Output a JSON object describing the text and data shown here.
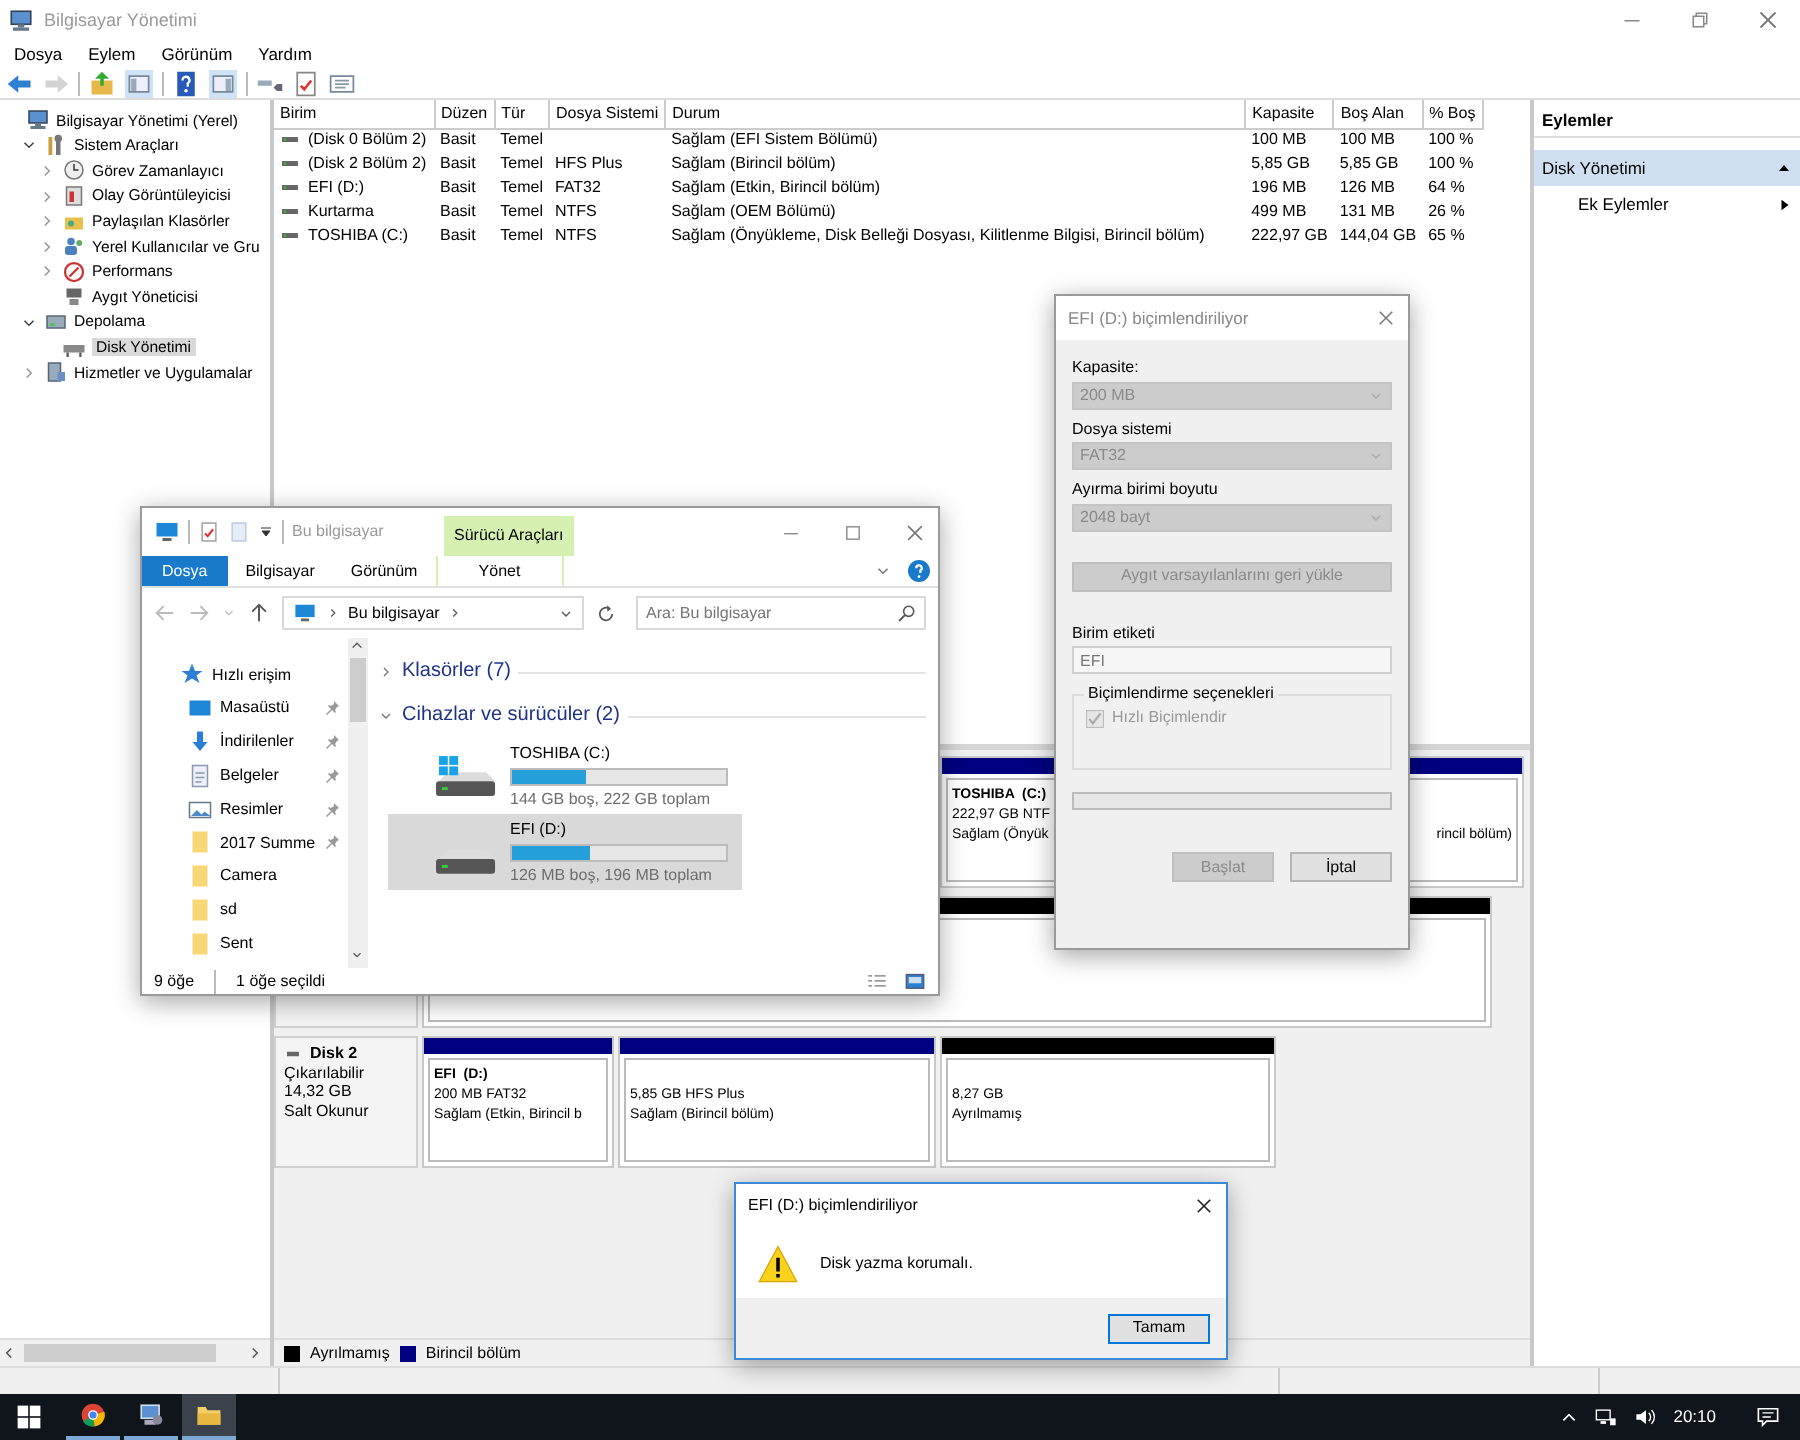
{
  "main_window": {
    "title": "Bilgisayar Yönetimi",
    "menu": [
      "Dosya",
      "Eylem",
      "Görünüm",
      "Yardım"
    ]
  },
  "toolbar": [
    {
      "kind": "back",
      "disabled": false
    },
    {
      "kind": "forward",
      "disabled": true
    },
    {
      "kind": "up",
      "disabled": false
    },
    {
      "kind": "tree",
      "disabled": false
    },
    {
      "kind": "help",
      "disabled": false
    },
    {
      "kind": "pane",
      "disabled": false
    },
    {
      "kind": "connect",
      "disabled": false
    },
    {
      "kind": "check",
      "disabled": false
    },
    {
      "kind": "properties",
      "disabled": false
    }
  ],
  "tree": [
    {
      "label": "Bilgisayar Yönetimi (Yerel)",
      "kind": "computer",
      "selected": false,
      "children": [
        {
          "label": "Sistem Araçları",
          "kind": "tools",
          "expanded": true,
          "selected": false,
          "children": [
            {
              "label": "Görev Zamanlayıcı",
              "kind": "clock",
              "expanded": false,
              "selected": false
            },
            {
              "label": "Olay Görüntüleyicisi",
              "kind": "log",
              "expanded": false,
              "selected": false
            },
            {
              "label": "Paylaşılan Klasörler",
              "kind": "share",
              "expanded": false,
              "selected": false
            },
            {
              "label": "Yerel Kullanıcılar ve Gru",
              "kind": "users",
              "expanded": false,
              "selected": false
            },
            {
              "label": "Performans",
              "kind": "perf",
              "expanded": false,
              "selected": false
            },
            {
              "label": "Aygıt Yöneticisi",
              "kind": "device",
              "selected": false
            }
          ]
        },
        {
          "label": "Depolama",
          "kind": "storage",
          "expanded": true,
          "selected": false,
          "children": [
            {
              "label": "Disk Yönetimi",
              "kind": "disk",
              "selected": true
            }
          ]
        },
        {
          "label": "Hizmetler ve Uygulamalar",
          "kind": "services",
          "expanded": false,
          "selected": false
        }
      ]
    }
  ],
  "volume_table": {
    "columns": [
      "Birim",
      "Düzen",
      "Tür",
      "Dosya Sistemi",
      "Durum",
      "Kapasite",
      "Boş Alan",
      "% Boş"
    ],
    "rows": [
      [
        "(Disk 0 Bölüm 2)",
        "Basit",
        "Temel",
        "",
        "Sağlam (EFI Sistem Bölümü)",
        "100 MB",
        "100 MB",
        "100 %"
      ],
      [
        "(Disk 2 Bölüm 2)",
        "Basit",
        "Temel",
        "HFS Plus",
        "Sağlam (Birincil bölüm)",
        "5,85 GB",
        "5,85 GB",
        "100 %"
      ],
      [
        "EFI (D:)",
        "Basit",
        "Temel",
        "FAT32",
        "Sağlam (Etkin, Birincil bölüm)",
        "196 MB",
        "126 MB",
        "64 %"
      ],
      [
        "Kurtarma",
        "Basit",
        "Temel",
        "NTFS",
        "Sağlam (OEM Bölümü)",
        "499 MB",
        "131 MB",
        "26 %"
      ],
      [
        "TOSHIBA (C:)",
        "Basit",
        "Temel",
        "NTFS",
        "Sağlam (Önyükleme, Disk Belleği Dosyası, Kilitlenme Bilgisi, Birincil bölüm)",
        "222,97 GB",
        "144,04 GB",
        "65 %"
      ]
    ]
  },
  "disks": [
    {
      "partitions": [
        {
          "kind": "primary",
          "title": "TOSHIBA  (C:)",
          "lines": [
            "222,97 GB NTF",
            "Sağlam (Önyük"
          ],
          "tail": "rincil bölüm)"
        }
      ]
    },
    {
      "partitions": [
        {
          "kind": "unallocated"
        }
      ]
    },
    {
      "name": "Disk 2",
      "lines": [
        "Çıkarılabilir",
        "14,32 GB",
        "Salt Okunur"
      ],
      "partitions": [
        {
          "kind": "primary",
          "title": "EFI  (D:)",
          "lines": [
            "200 MB FAT32",
            "Sağlam (Etkin, Birincil b"
          ]
        },
        {
          "kind": "primary",
          "lines": [
            "5,85 GB HFS Plus",
            "Sağlam (Birincil bölüm)"
          ]
        },
        {
          "kind": "unallocated",
          "lines": [
            "8,27 GB",
            "Ayrılmamış"
          ]
        }
      ]
    }
  ],
  "legend": [
    {
      "label": "Ayrılmamış",
      "color": "#000000"
    },
    {
      "label": "Birincil bölüm",
      "color": "#000080"
    }
  ],
  "actions": {
    "title": "Eylemler",
    "section": {
      "label": "Disk Yönetimi",
      "expanded": true
    },
    "items": [
      "Ek Eylemler"
    ]
  },
  "explorer": {
    "title": "Bu bilgisayar",
    "context_group": "Sürücü Araçları",
    "tabs": [
      {
        "label": "Dosya",
        "kind": "file"
      },
      {
        "label": "Bilgisayar",
        "kind": "tab"
      },
      {
        "label": "Görünüm",
        "kind": "tab"
      },
      {
        "label": "Yönet",
        "kind": "context"
      }
    ],
    "address": "Bu bilgisayar",
    "search_placeholder": "Ara: Bu bilgisayar",
    "nav": [
      {
        "label": "Hızlı erişim",
        "kind": "quick",
        "pinned": false
      },
      {
        "label": "Masaüstü",
        "kind": "desktop",
        "pinned": true
      },
      {
        "label": "İndirilenler",
        "kind": "downloads",
        "pinned": true
      },
      {
        "label": "Belgeler",
        "kind": "documents",
        "pinned": true
      },
      {
        "label": "Resimler",
        "kind": "pictures",
        "pinned": true
      },
      {
        "label": "2017 Summe",
        "kind": "folder",
        "pinned": true
      },
      {
        "label": "Camera",
        "kind": "folder",
        "pinned": false
      },
      {
        "label": "sd",
        "kind": "folder",
        "pinned": false
      },
      {
        "label": "Sent",
        "kind": "folder",
        "pinned": false
      }
    ],
    "groups": [
      {
        "label": "Klasörler (7)",
        "expanded": false
      },
      {
        "label": "Cihazlar ve sürücüler (2)",
        "expanded": true
      }
    ],
    "drives": [
      {
        "name": "TOSHIBA (C:)",
        "kind": "system",
        "level": 0.35,
        "info": "144 GB boş, 222 GB toplam",
        "selected": false
      },
      {
        "name": "EFI (D:)",
        "kind": "plain",
        "level": 0.36,
        "info": "126 MB boş, 196 MB toplam",
        "selected": true
      }
    ],
    "status": [
      "9 öğe",
      "1 öğe seçildi"
    ]
  },
  "format_dialog": {
    "title": "EFI (D:) biçimlendiriliyor",
    "fields": [
      {
        "label": "Kapasite:",
        "value": "200 MB",
        "disabled": true
      },
      {
        "label": "Dosya sistemi",
        "value": "FAT32",
        "disabled": true
      },
      {
        "label": "Ayırma birimi boyutu",
        "value": "2048 bayt",
        "disabled": true
      }
    ],
    "restore_button": {
      "label": "Aygıt varsayılanlarını geri yükle",
      "disabled": true
    },
    "volume_label": {
      "label": "Birim etiketi",
      "value": "EFI"
    },
    "options": {
      "title": "Biçimlendirme seçenekleri",
      "checkbox": {
        "label": "Hızlı Biçimlendir",
        "checked": true,
        "disabled": true
      }
    },
    "progress": {
      "level": 0
    },
    "buttons": [
      {
        "label": "Başlat",
        "disabled": true
      },
      {
        "label": "İptal",
        "disabled": false
      }
    ]
  },
  "message_box": {
    "title": "EFI (D:) biçimlendiriliyor",
    "message": "Disk yazma korumalı.",
    "button": "Tamam"
  },
  "taskbar": {
    "apps": [
      {
        "kind": "browser",
        "selected": false
      },
      {
        "kind": "management",
        "selected": false
      },
      {
        "kind": "folder",
        "selected": true
      }
    ],
    "clock": "20:10"
  }
}
